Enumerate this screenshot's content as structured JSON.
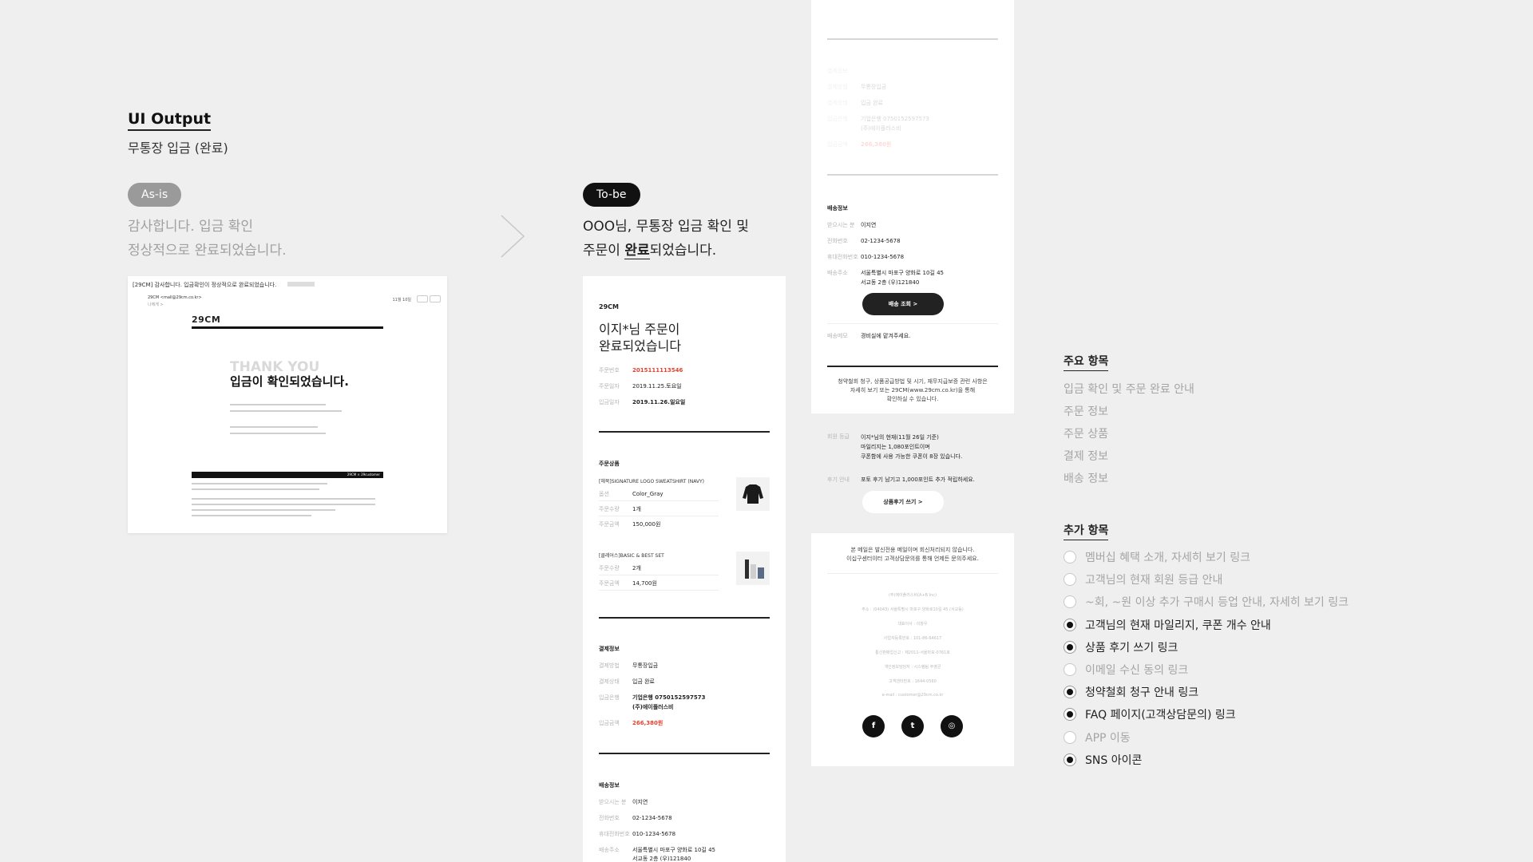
{
  "header": {
    "title": "UI Output",
    "subtitle": "무통장 입금 (완료)"
  },
  "asis": {
    "pill": "As-is",
    "copy_line1": "감사합니다. 입금 확인",
    "copy_line2": "정상적으로 완료되었습니다."
  },
  "tobe": {
    "pill": "To-be",
    "copy_line1": "OOO님, 무통장 입금 확인 및",
    "copy_line2_pre": "주문이 ",
    "copy_line2_bold": "완료",
    "copy_line2_post": "되었습니다."
  },
  "mail": {
    "subject": "[29CM] 감사합니다. 입금확인이 정상적으로 완료되었습니다.",
    "from": "29CM <mall@29cm.co.kr>",
    "to": "나에게 >",
    "date": "11월 10일",
    "logo": "29CM",
    "thank_you": "THANK YOU",
    "confirmed": "입금이 확인되었습니다.",
    "bar_text": "29CM × 29customer"
  },
  "phone1": {
    "logo": "29CM",
    "headline_1": "이지*님 주문이",
    "headline_2": "완료되었습니다",
    "order": [
      {
        "k": "주문번호",
        "v": "2015111113546"
      },
      {
        "k": "주문일자",
        "v": "2019.11.25.토요일"
      },
      {
        "k": "입금일자",
        "v": "2019.11.26.일요일"
      }
    ],
    "products_title": "주문상품",
    "product1": {
      "name": "[헤북]SIGNATURE LOGO SWEATSHIRT (NAVY)",
      "rows": [
        {
          "k": "옵션",
          "v": "Color_Gray"
        },
        {
          "k": "주문수량",
          "v": "1개"
        },
        {
          "k": "주문금액",
          "v": "150,000원"
        }
      ]
    },
    "product2": {
      "name": "[클레어스]BASIC & BEST SET",
      "rows": [
        {
          "k": "주문수량",
          "v": "2개"
        },
        {
          "k": "주문금액",
          "v": "14,700원"
        }
      ]
    },
    "payment_title": "결제정보",
    "payment": [
      {
        "k": "결제방법",
        "v": "무통장입금"
      },
      {
        "k": "결제상태",
        "v": "입금 완료"
      },
      {
        "k": "입금은행",
        "v": "기업은행 0750152597573"
      },
      {
        "k": "",
        "v": "(주)에이플러스비"
      },
      {
        "k": "입금금액",
        "v": "266,380원"
      }
    ],
    "delivery_title": "배송정보",
    "delivery": [
      {
        "k": "받으시는 분",
        "v": "이지연"
      },
      {
        "k": "전화번호",
        "v": "02-1234-5678"
      },
      {
        "k": "휴대전화번호",
        "v": "010-1234-5678"
      },
      {
        "k": "배송주소",
        "v": "서울특별시 마포구 양화로 10길 45"
      },
      {
        "k": "",
        "v": "서교동 2층 (우)121840"
      }
    ]
  },
  "phone2": {
    "faded_top": [
      {
        "k": "결제정보",
        "v": ""
      },
      {
        "k": "결제방법",
        "v": "무통장입금"
      },
      {
        "k": "결제상태",
        "v": "입금 완료"
      },
      {
        "k": "입금은행",
        "v": "기업은행 0750152597573"
      },
      {
        "k": "",
        "v": "(주)에이플러스비"
      },
      {
        "k": "입금금액",
        "v": "266,380원"
      }
    ],
    "delivery_title": "배송정보",
    "delivery": [
      {
        "k": "받으시는 분",
        "v": "이지연"
      },
      {
        "k": "전화번호",
        "v": "02-1234-5678"
      },
      {
        "k": "휴대전화번호",
        "v": "010-1234-5678"
      },
      {
        "k": "배송주소",
        "v": "서울특별시 마포구 양화로 10길 45"
      },
      {
        "k": "",
        "v": "서교동 2층 (우)121840"
      }
    ],
    "track_button": "배송 조회 >",
    "memo_k": "배송메모",
    "memo_v": "경비실에 맡겨주세요.",
    "policy_1": "청약철회 청구, 상품공급방법 및 시기, 재무지급보증 관련 사항은",
    "policy_2": "자세히 보기 또는 29CM(www.29cm.co.kr)을 통해",
    "policy_3": "확인하실 수 있습니다.",
    "grade_k": "회원 등급",
    "grade_1": "이지*님의 현재(11월 26일 기준)",
    "grade_2": "마일리지는 1,080포인트이며",
    "grade_3": "쿠폰함에 사용 가능한 쿠폰이 8장 있습니다.",
    "review_k": "후기 안내",
    "review_v": "포토 후기 남기고 1,000포인트 추가 적립하세요.",
    "review_button": "상품후기 쓰기 >",
    "notice_1": "본 메일은 발신전용 메일이며 회신처리되지 않습니다.",
    "notice_2": "이십구센터이터 고객상담문의를 통해 언제든 문의주세요.",
    "footer": [
      "(주)에이플러스비(A+B Inc)",
      "주소 : (04043) 서울특별시 마포구 양화로10길 45 (서교동)",
      "대표이사 : 이창우",
      "사업자등록번호 : 101-86-64617",
      "통신판매업신고 : 제2011-서울마포-0761호",
      "개인정보담당자 : 시스템팀 주영균",
      "고객센터번호 : 1644-0560",
      "e-mail : customer@29cm.co.kr"
    ],
    "sns": [
      "f",
      "t",
      "◎"
    ]
  },
  "main_items": {
    "title": "주요 항목",
    "items": [
      "입금 확인 및 주문 완료 안내",
      "주문 정보",
      "주문 상품",
      "결제 정보",
      "배송 정보"
    ]
  },
  "extra_items": {
    "title": "추가 항목",
    "items": [
      {
        "label": "멤버십 혜택 소개, 자세히 보기 링크",
        "checked": false
      },
      {
        "label": "고객님의 현재 회원 등급 안내",
        "checked": false
      },
      {
        "label": "~회, ~원 이상 추가 구매시 등업 안내, 자세히 보기 링크",
        "checked": false
      },
      {
        "label": "고객님의 현재 마일리지, 쿠폰 개수 안내",
        "checked": true
      },
      {
        "label": "상품 후기 쓰기 링크",
        "checked": true
      },
      {
        "label": "이메일 수신 동의 링크",
        "checked": false
      },
      {
        "label": "청약철회 청구 안내 링크",
        "checked": true
      },
      {
        "label": "FAQ 페이지(고객상담문의) 링크",
        "checked": true
      },
      {
        "label": "APP 이동",
        "checked": false
      },
      {
        "label": "SNS 아이콘",
        "checked": true
      }
    ]
  },
  "colors": {
    "accent": "#e8402f",
    "dark": "#111111",
    "muted": "#a5a5a5"
  }
}
